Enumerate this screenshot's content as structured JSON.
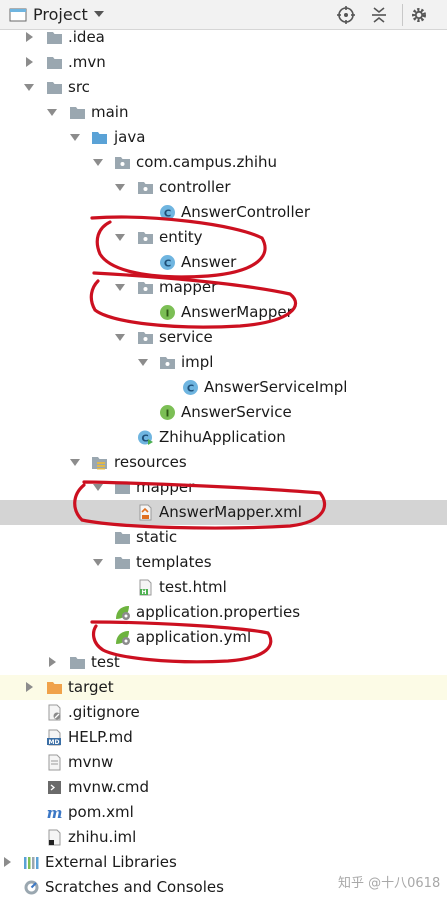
{
  "toolbar": {
    "title": "Project",
    "icons": [
      "project-view-icon",
      "locate-icon",
      "collapse-all-icon",
      "settings-icon"
    ]
  },
  "tree": {
    "idea": ".idea",
    "mvn": ".mvn",
    "src": "src",
    "main": "main",
    "java": "java",
    "package": "com.campus.zhihu",
    "controller": "controller",
    "answer_controller": "AnswerController",
    "entity": "entity",
    "answer": "Answer",
    "mapper": "mapper",
    "answer_mapper": "AnswerMapper",
    "service": "service",
    "impl": "impl",
    "answer_service_impl": "AnswerServiceImpl",
    "answer_service": "AnswerService",
    "zhihu_application": "ZhihuApplication",
    "resources": "resources",
    "res_mapper": "mapper",
    "answer_mapper_xml": "AnswerMapper.xml",
    "static": "static",
    "templates": "templates",
    "test_html": "test.html",
    "application_properties": "application.properties",
    "application_yml": "application.yml",
    "test": "test",
    "target": "target",
    "gitignore": ".gitignore",
    "help_md": "HELP.md",
    "mvnw": "mvnw",
    "mvnw_cmd": "mvnw.cmd",
    "pom_xml": "pom.xml",
    "zhihu_iml": "zhihu.iml",
    "external_libraries": "External Libraries",
    "scratches": "Scratches and Consoles"
  },
  "watermark": "知乎 @十八0618",
  "colors": {
    "annotation": "#cc1020",
    "selection": "#d4d4d4",
    "class_icon": "#6fb5e0",
    "interface_icon": "#7cbf55",
    "folder": "#9aa7b0",
    "folder_source": "#5aa2d6",
    "folder_excluded": "#f0a24a"
  }
}
